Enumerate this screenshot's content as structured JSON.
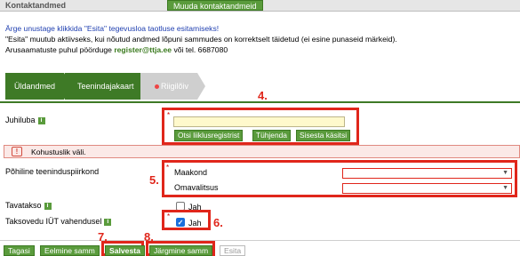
{
  "header": {
    "title": "Kontaktandmed",
    "edit_button": "Muuda kontaktandmeid"
  },
  "notice": {
    "line1": "Ärge unustage klikkida \"Esita\" tegevusloa taotluse esitamiseks!",
    "line2": "\"Esita\" muutub aktiivseks, kui nõutud andmed lõpuni sammudes on korrektselt täidetud (ei esine punaseid märkeid).",
    "line3_prefix": "Arusaamatuste puhul pöörduge",
    "email": "register@ttja.ee",
    "line3_suffix": "või tel. 6687080"
  },
  "tabs": [
    {
      "label": "Üldandmed"
    },
    {
      "label": "Teenindajakaart"
    },
    {
      "label": "Riigilõiv"
    }
  ],
  "form": {
    "juhiluba": {
      "label": "Juhiluba",
      "value": "",
      "btn_search": "Otsi liiklusregistrist",
      "btn_clear": "Tühjenda",
      "btn_manual": "Sisesta käsitsi"
    },
    "error": {
      "icon": "!",
      "message": "Kohustuslik väli."
    },
    "area": {
      "label": "Põhiline teeninduspiirkond",
      "county_label": "Maakond",
      "county_value": "",
      "municipality_label": "Omavalitsus",
      "municipality_value": ""
    },
    "tavatakso": {
      "label": "Tavatakso",
      "checkbox_label": "Jah",
      "checked": false
    },
    "taksovedu": {
      "label": "Taksovedu IÜT vahendusel",
      "checkbox_label": "Jah",
      "checked": true
    }
  },
  "markers": {
    "m4": "4.",
    "m5": "5.",
    "m6": "6.",
    "m7": "7.",
    "m8": "8."
  },
  "info_icon": "i",
  "required_mark": "*",
  "bottom": {
    "back": "Tagasi",
    "prev": "Eelmine samm",
    "save": "Salvesta",
    "next": "Järgmine samm",
    "submit": "Esita"
  },
  "colors": {
    "accent": "#3e7a26",
    "highlight": "#e0261b",
    "error_bg": "#fbe9e7"
  }
}
